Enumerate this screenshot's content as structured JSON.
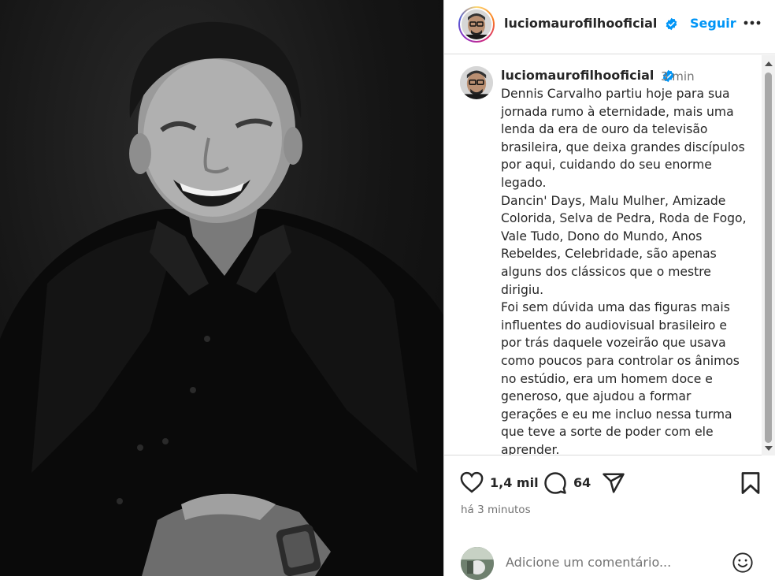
{
  "post": {
    "username": "luciomaurofilhooficial",
    "follow_label": "Seguir",
    "time_short": "3 min",
    "caption": "Dennis Carvalho partiu hoje para sua\njornada rumo à eternidade, mais uma\nlenda da era de ouro da televisão\nbrasileira, que deixa grandes discípulos\npor aqui, cuidando do seu enorme\nlegado.\nDancin' Days, Malu Mulher, Amizade\nColorida, Selva de Pedra, Roda de Fogo,\nVale Tudo, Dono do Mundo, Anos\nRebeldes, Celebridade, são apenas\nalguns dos clássicos que o mestre\ndirigiu.\nFoi sem dúvida uma das figuras mais\ninfluentes do audiovisual brasileiro e\npor trás daquele vozeirão que usava\ncomo poucos para controlar os ânimos\nno estúdio, era um homem doce e\ngeneroso, que ajudou a formar\ngerações e eu me incluo nessa turma\nque teve a sorte de poder com ele\naprender.",
    "likes": "1,4 mil",
    "comments": "64",
    "time_ago": "há 3 minutos",
    "comment_placeholder": "Adicione um comentário..."
  },
  "icons": {
    "verified": "verified-badge-icon",
    "more": "more-options-icon",
    "like": "heart-icon",
    "comment": "comment-bubble-icon",
    "share": "paper-plane-icon",
    "save": "bookmark-icon",
    "emoji": "emoji-smile-icon"
  },
  "colors": {
    "accent": "#0095f6",
    "verified": "#0095f6",
    "muted": "#737373",
    "text": "#262626",
    "border": "#dbdbdb"
  }
}
